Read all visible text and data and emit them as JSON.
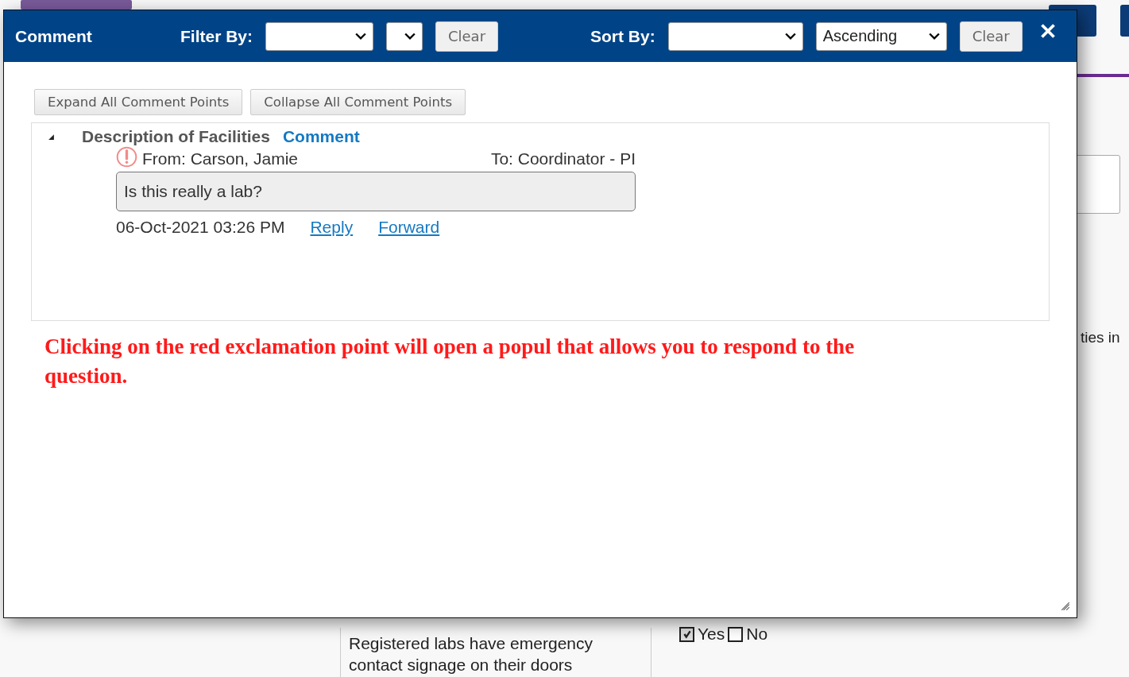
{
  "background": {
    "side_text": "ties in",
    "note": "Registered labs have emergency contact signage on their doors",
    "choices": [
      {
        "label": "Yes",
        "checked": true
      },
      {
        "label": "No",
        "checked": false
      }
    ]
  },
  "dialog": {
    "title": "Comment",
    "filter": {
      "label": "Filter By:",
      "clear": "Clear"
    },
    "sort": {
      "label": "Sort By:",
      "order": "Ascending",
      "clear": "Clear"
    },
    "buttons": [
      "Expand All Comment Points",
      "Collapse All Comment Points"
    ],
    "comment_points": [
      {
        "title": "Description of Facilities",
        "link": "Comment",
        "expanded": true,
        "comments": [
          {
            "from": "From: Carson, Jamie",
            "to": "To: Coordinator - PI",
            "text": "Is this really a lab?",
            "time": "06-Oct-2021 03:26 PM",
            "actions": [
              "Reply",
              "Forward"
            ]
          }
        ]
      }
    ],
    "note": "Clicking on the red exclamation point will open a popul that allows you to respond to the question."
  }
}
